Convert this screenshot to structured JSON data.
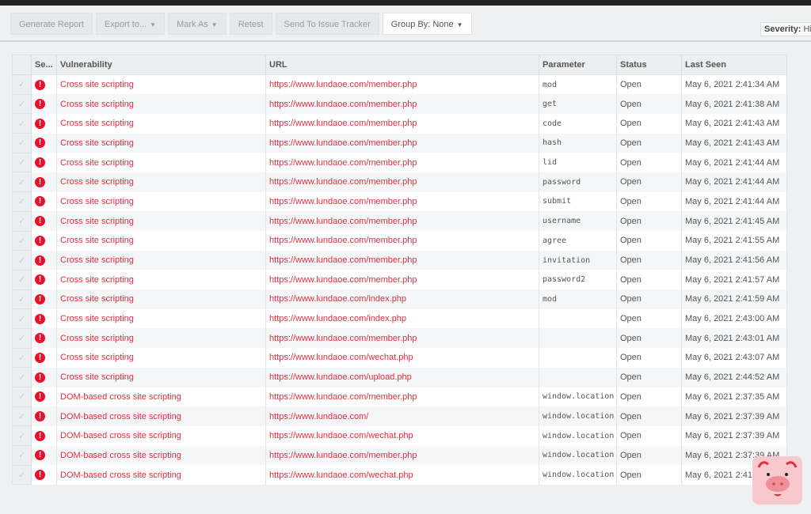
{
  "toolbar": {
    "generate": "Generate Report",
    "export": "Export to...",
    "mark": "Mark As",
    "retest": "Retest",
    "send": "Send To Issue Tracker",
    "group": "Group By: None",
    "severity_label": "Severity:",
    "severity_value": "Hi"
  },
  "columns": [
    "Se...",
    "Vulnerability",
    "URL",
    "Parameter",
    "Status",
    "Last Seen"
  ],
  "rows": [
    [
      "Cross site scripting",
      "https://www.lundaoe.com/member.php",
      "mod",
      "Open",
      "May 6, 2021 2:41:34 AM"
    ],
    [
      "Cross site scripting",
      "https://www.lundaoe.com/member.php",
      "get",
      "Open",
      "May 6, 2021 2:41:38 AM"
    ],
    [
      "Cross site scripting",
      "https://www.lundaoe.com/member.php",
      "code",
      "Open",
      "May 6, 2021 2:41:43 AM"
    ],
    [
      "Cross site scripting",
      "https://www.lundaoe.com/member.php",
      "hash",
      "Open",
      "May 6, 2021 2:41:43 AM"
    ],
    [
      "Cross site scripting",
      "https://www.lundaoe.com/member.php",
      "lid",
      "Open",
      "May 6, 2021 2:41:44 AM"
    ],
    [
      "Cross site scripting",
      "https://www.lundaoe.com/member.php",
      "password",
      "Open",
      "May 6, 2021 2:41:44 AM"
    ],
    [
      "Cross site scripting",
      "https://www.lundaoe.com/member.php",
      "submit",
      "Open",
      "May 6, 2021 2:41:44 AM"
    ],
    [
      "Cross site scripting",
      "https://www.lundaoe.com/member.php",
      "username",
      "Open",
      "May 6, 2021 2:41:45 AM"
    ],
    [
      "Cross site scripting",
      "https://www.lundaoe.com/member.php",
      "agree",
      "Open",
      "May 6, 2021 2:41:55 AM"
    ],
    [
      "Cross site scripting",
      "https://www.lundaoe.com/member.php",
      "invitation",
      "Open",
      "May 6, 2021 2:41:56 AM"
    ],
    [
      "Cross site scripting",
      "https://www.lundaoe.com/member.php",
      "password2",
      "Open",
      "May 6, 2021 2:41:57 AM"
    ],
    [
      "Cross site scripting",
      "https://www.lundaoe.com/index.php",
      "mod",
      "Open",
      "May 6, 2021 2:41:59 AM"
    ],
    [
      "Cross site scripting",
      "https://www.lundaoe.com/index.php",
      "",
      "Open",
      "May 6, 2021 2:43:00 AM"
    ],
    [
      "Cross site scripting",
      "https://www.lundaoe.com/member.php",
      "",
      "Open",
      "May 6, 2021 2:43:01 AM"
    ],
    [
      "Cross site scripting",
      "https://www.lundaoe.com/wechat.php",
      "",
      "Open",
      "May 6, 2021 2:43:07 AM"
    ],
    [
      "Cross site scripting",
      "https://www.lundaoe.com/upload.php",
      "",
      "Open",
      "May 6, 2021 2:44:52 AM"
    ],
    [
      "DOM-based cross site scripting",
      "https://www.lundaoe.com/member.php",
      "window.location",
      "Open",
      "May 6, 2021 2:37:35 AM"
    ],
    [
      "DOM-based cross site scripting",
      "https://www.lundaoe.com/",
      "window.location",
      "Open",
      "May 6, 2021 2:37:39 AM"
    ],
    [
      "DOM-based cross site scripting",
      "https://www.lundaoe.com/wechat.php",
      "window.location",
      "Open",
      "May 6, 2021 2:37:39 AM"
    ],
    [
      "DOM-based cross site scripting",
      "https://www.lundaoe.com/member.php",
      "window.location",
      "Open",
      "May 6, 2021 2:37:39 AM"
    ],
    [
      "DOM-based cross site scripting",
      "https://www.lundaoe.com/wechat.php",
      "window.location",
      "Open",
      "May 6, 2021 2:41:3"
    ]
  ],
  "severity_icon": "exclamation-circle-icon",
  "accent": "#e0303d"
}
